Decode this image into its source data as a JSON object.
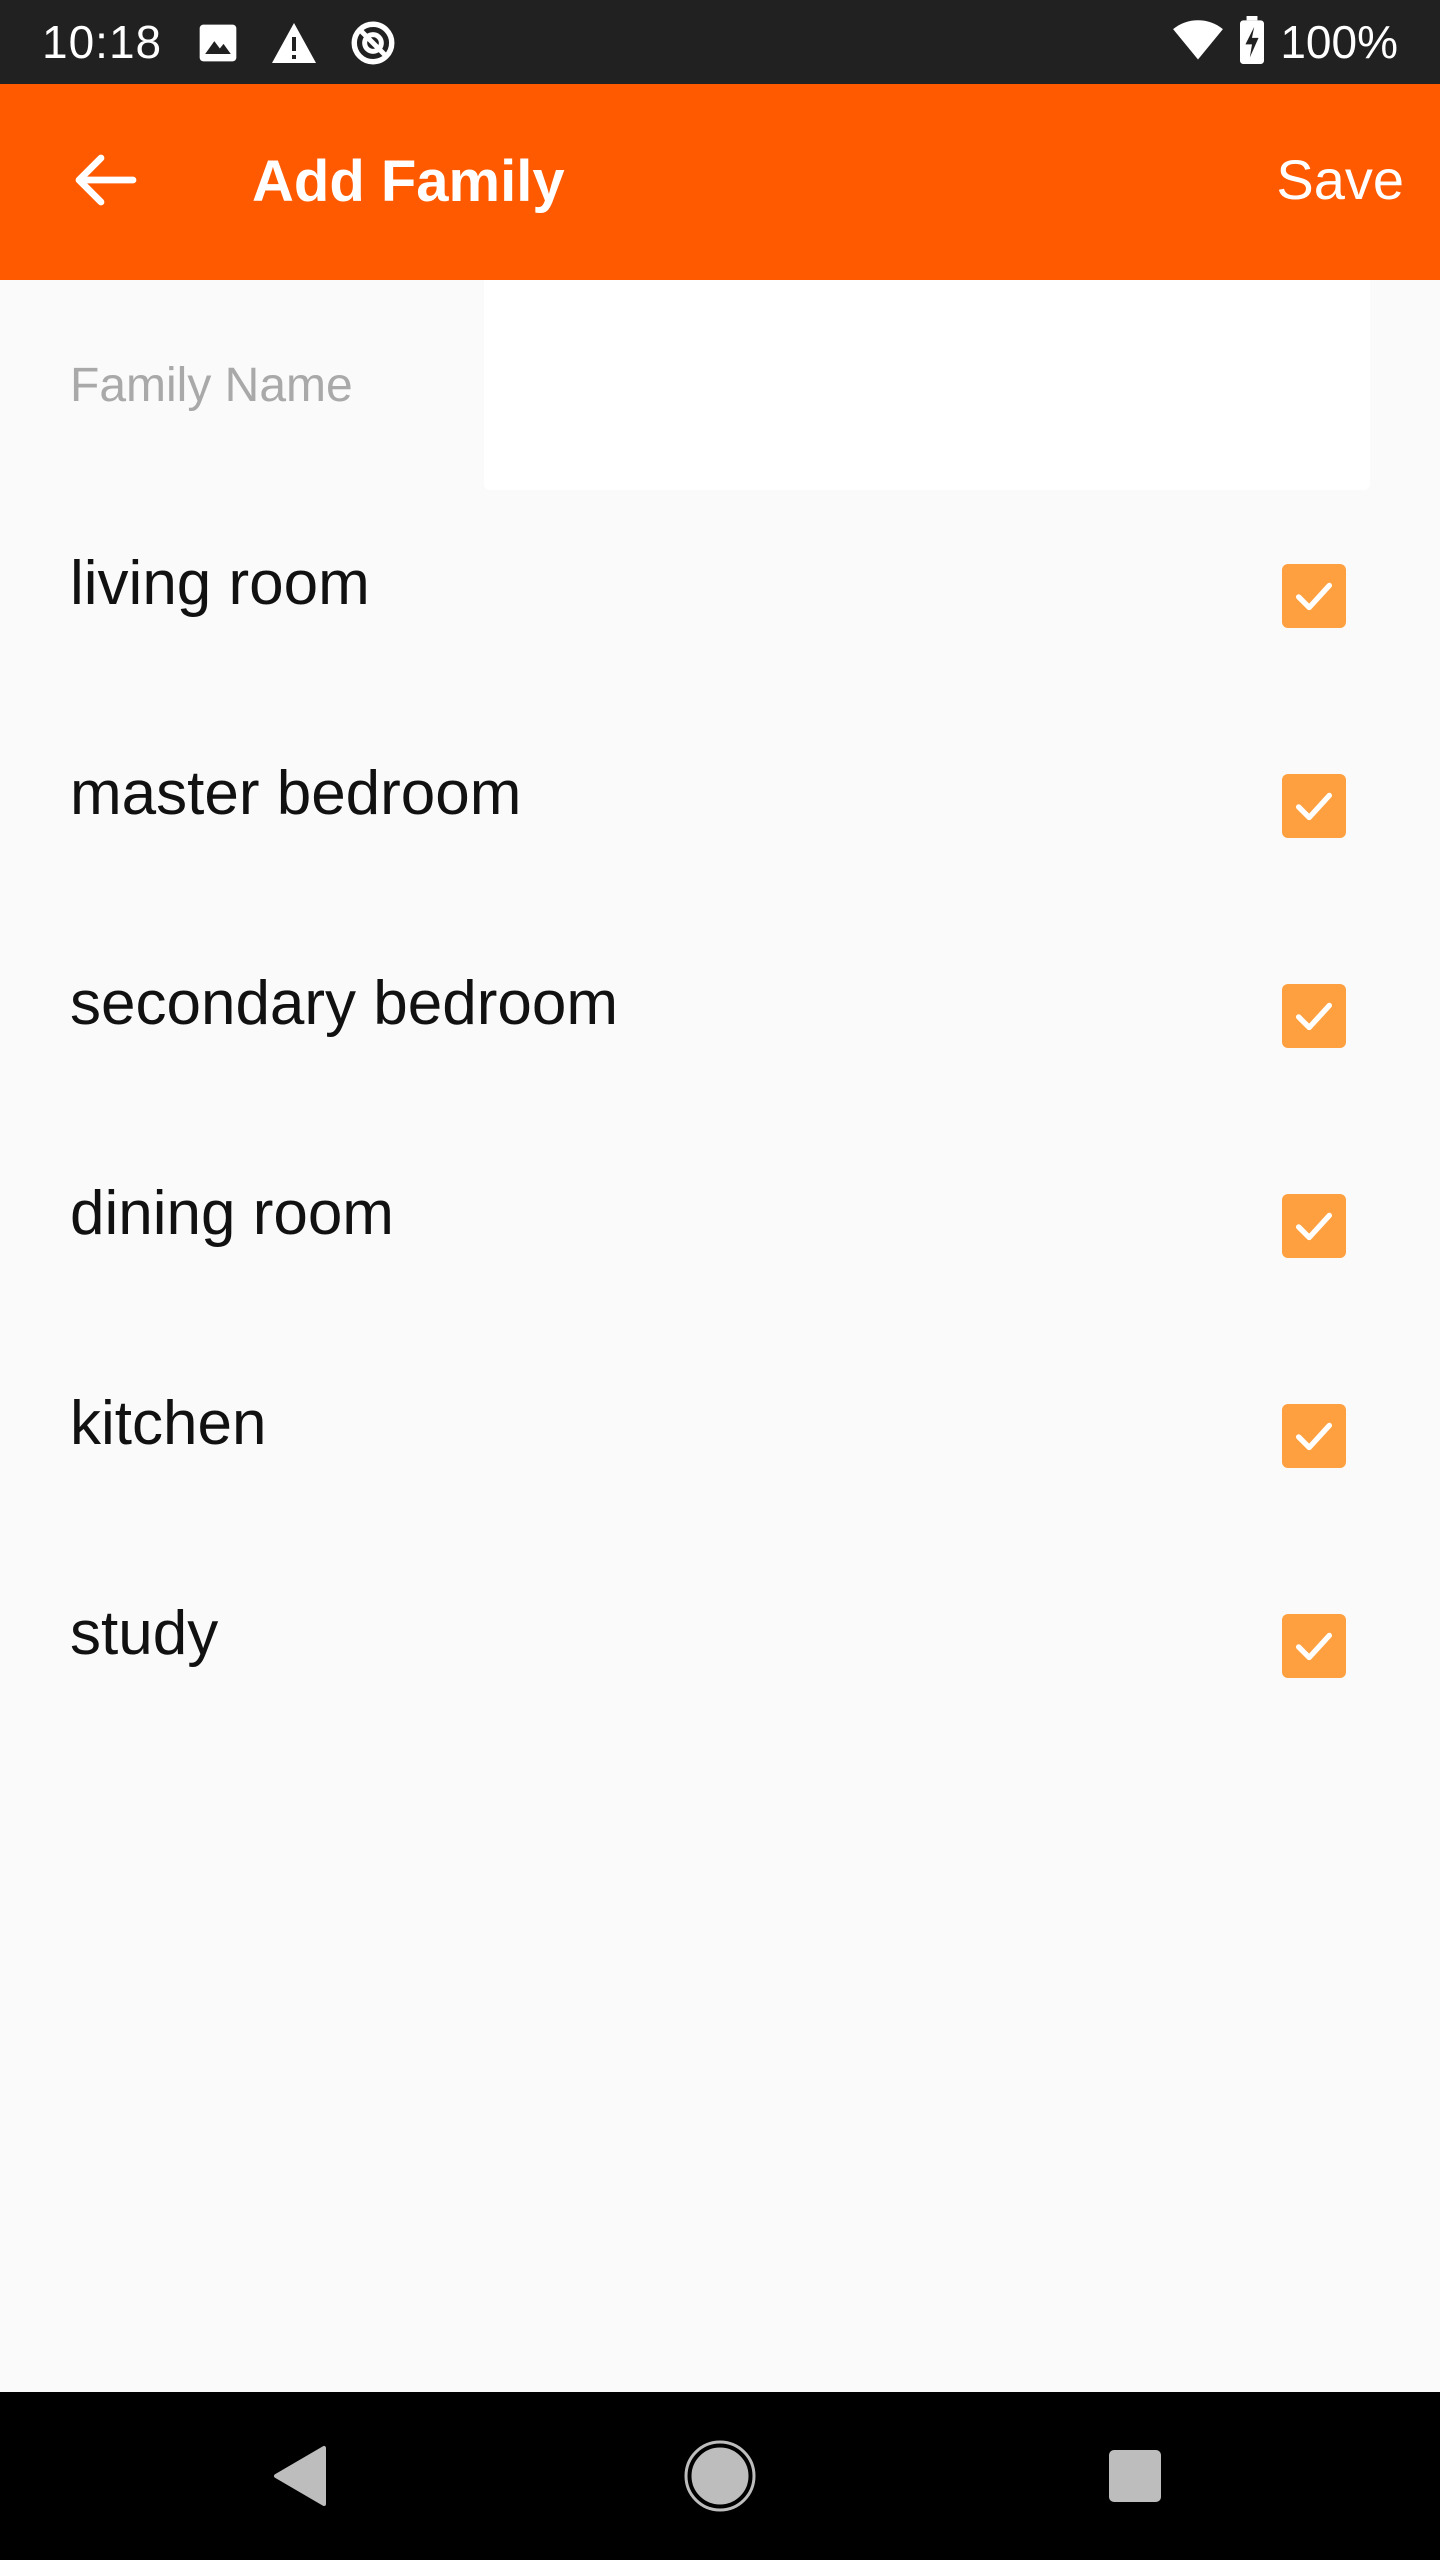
{
  "status_bar": {
    "time": "10:18",
    "battery_percent": "100%",
    "left_icons": [
      "image-icon",
      "warning-icon",
      "data-saver-icon"
    ],
    "right_icons": [
      "wifi-icon",
      "battery-charging-icon"
    ]
  },
  "app_bar": {
    "title": "Add Family",
    "save_label": "Save",
    "back_icon": "arrow-left-icon",
    "color": "#ff5a00"
  },
  "form": {
    "family_name_label": "Family Name",
    "family_name_value": ""
  },
  "rooms": [
    {
      "label": "living room",
      "checked": true
    },
    {
      "label": "master bedroom",
      "checked": true
    },
    {
      "label": "secondary bedroom",
      "checked": true
    },
    {
      "label": "dining room",
      "checked": true
    },
    {
      "label": "kitchen",
      "checked": true
    },
    {
      "label": "study",
      "checked": true
    }
  ],
  "colors": {
    "checkbox": "#ffa040",
    "background": "#fafafa"
  },
  "nav_bar": {
    "icons": [
      "back-triangle-icon",
      "home-circle-icon",
      "recents-square-icon"
    ]
  }
}
